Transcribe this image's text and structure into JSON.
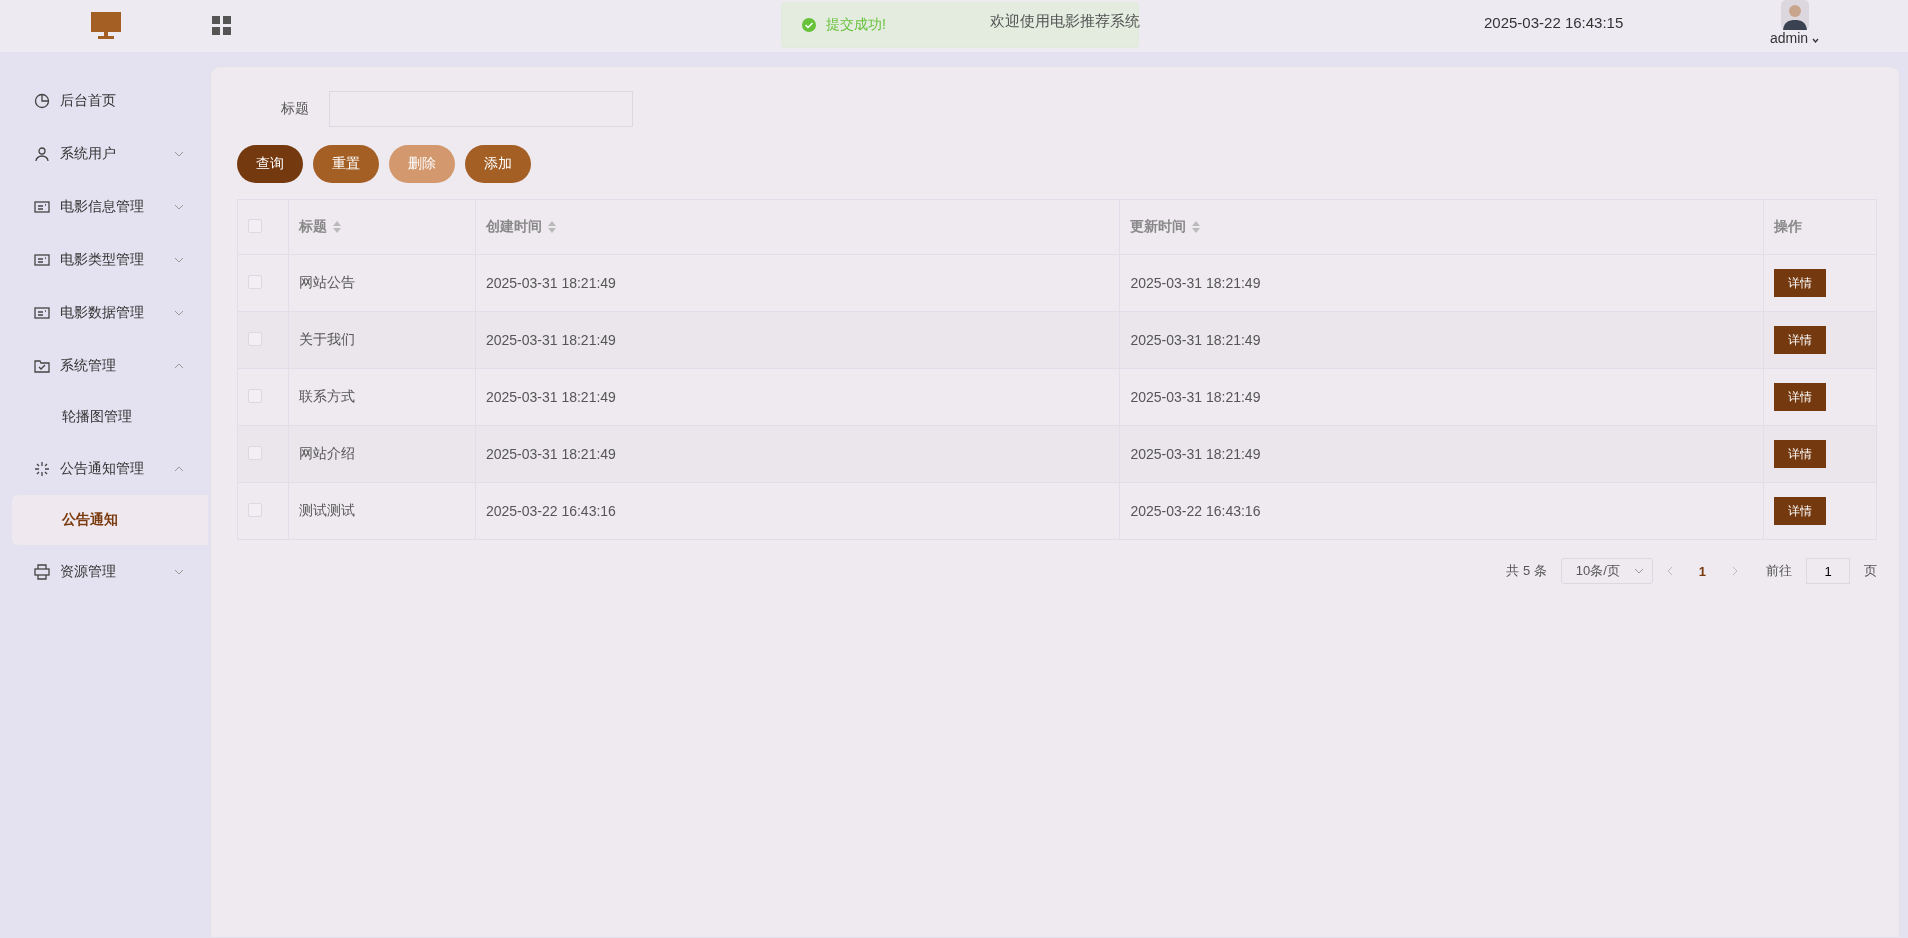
{
  "header": {
    "title": "欢迎使用电影推荐系统",
    "datetime": "2025-03-22 16:43:15",
    "user": "admin"
  },
  "toast": {
    "kind": "success",
    "message": "提交成功!"
  },
  "sidebar": {
    "items": [
      {
        "label": "后台首页"
      },
      {
        "label": "系统用户",
        "expanded": false
      },
      {
        "label": "电影信息管理",
        "expanded": false
      },
      {
        "label": "电影类型管理",
        "expanded": false
      },
      {
        "label": "电影数据管理",
        "expanded": false
      },
      {
        "label": "系统管理",
        "expanded": true,
        "children": [
          {
            "label": "轮播图管理",
            "selected": false
          }
        ]
      },
      {
        "label": "公告通知管理",
        "expanded": true,
        "children": [
          {
            "label": "公告通知",
            "selected": true
          }
        ]
      },
      {
        "label": "资源管理",
        "expanded": false
      }
    ]
  },
  "filter": {
    "label": "标题"
  },
  "buttons": [
    {
      "label": "查询",
      "kind": "query"
    },
    {
      "label": "重置",
      "kind": "reset"
    },
    {
      "label": "删除",
      "kind": "delete",
      "disabled": true
    },
    {
      "label": "添加",
      "kind": "add"
    }
  ],
  "table": {
    "select_all_checked": false,
    "columns": [
      {
        "label": "标题",
        "sortable": true
      },
      {
        "label": "创建时间",
        "sortable": true
      },
      {
        "label": "更新时间",
        "sortable": true
      },
      {
        "label": "操作",
        "sortable": false
      }
    ],
    "rows": [
      {
        "title": "网站公告",
        "created": "2025-03-31 18:21:49",
        "updated": "2025-03-31 18:21:49",
        "action": "详情",
        "checked": false
      },
      {
        "title": "关于我们",
        "created": "2025-03-31 18:21:49",
        "updated": "2025-03-31 18:21:49",
        "action": "详情",
        "checked": false
      },
      {
        "title": "联系方式",
        "created": "2025-03-31 18:21:49",
        "updated": "2025-03-31 18:21:49",
        "action": "详情",
        "checked": false
      },
      {
        "title": "网站介绍",
        "created": "2025-03-31 18:21:49",
        "updated": "2025-03-31 18:21:49",
        "action": "详情",
        "checked": false
      },
      {
        "title": "测试测试",
        "created": "2025-03-22 16:43:16",
        "updated": "2025-03-22 16:43:16",
        "action": "详情",
        "checked": false
      }
    ]
  },
  "pagination": {
    "total": "共 5 条",
    "page_size": "10条/页",
    "pages": [
      {
        "label": "1",
        "selected": true
      }
    ],
    "goto_label": "前往",
    "goto_value": "1",
    "goto_suffix": "页"
  }
}
